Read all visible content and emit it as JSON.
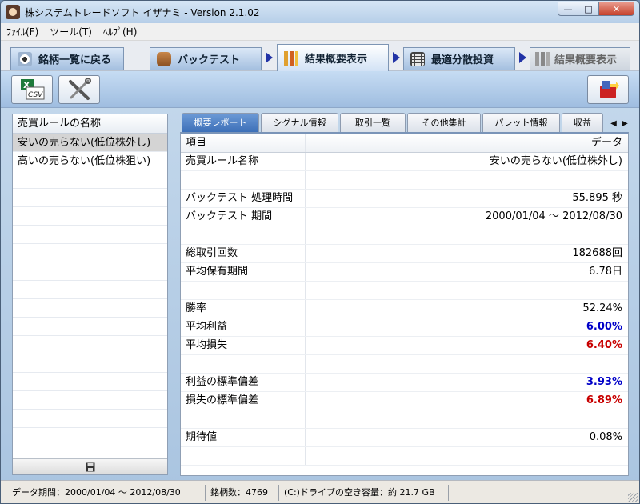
{
  "window": {
    "title": "株システムトレードソフト イザナミ - Version 2.1.02"
  },
  "menu": [
    "ﾌｧｲﾙ(F)",
    "ツール(T)",
    "ﾍﾙﾌﾟ(H)"
  ],
  "nav": {
    "tabs": [
      {
        "label": "銘柄一覧に戻る",
        "icon": "eye-icon"
      },
      {
        "label": "バックテスト",
        "icon": "bag-icon"
      },
      {
        "label": "結果概要表示",
        "icon": "bar-chart-icon",
        "active": true
      },
      {
        "label": "最適分散投資",
        "icon": "calculator-icon"
      },
      {
        "label": "結果概要表示",
        "icon": "bar-chart-icon",
        "disabled": true
      }
    ]
  },
  "toolbar": {
    "csv_label": "CSV"
  },
  "rules_list": {
    "header": "売買ルールの名称",
    "items": [
      "安いの売らない(低位株外し)",
      "高いの売らない(低位株狙い)"
    ],
    "selected_index": 0
  },
  "report_tabs": [
    "概要レポート",
    "シグナル情報",
    "取引一覧",
    "その他集計",
    "パレット情報",
    "収益"
  ],
  "report_grid": {
    "col_item": "項目",
    "col_data": "データ",
    "rows": [
      {
        "item": "売買ルール名称",
        "value": "安いの売らない(低位株外し)"
      },
      {
        "item": "",
        "value": ""
      },
      {
        "item": "バックテスト 処理時間",
        "value": "55.895 秒"
      },
      {
        "item": "バックテスト 期間",
        "value": "2000/01/04 ～ 2012/08/30"
      },
      {
        "item": "",
        "value": ""
      },
      {
        "item": "総取引回数",
        "value": "182688回"
      },
      {
        "item": "平均保有期間",
        "value": "6.78日"
      },
      {
        "item": "",
        "value": ""
      },
      {
        "item": "勝率",
        "value": "52.24%"
      },
      {
        "item": "平均利益",
        "value": "6.00%",
        "color": "blue"
      },
      {
        "item": "平均損失",
        "value": "6.40%",
        "color": "red"
      },
      {
        "item": "",
        "value": ""
      },
      {
        "item": "利益の標準偏差",
        "value": "3.93%",
        "color": "blue"
      },
      {
        "item": "損失の標準偏差",
        "value": "6.89%",
        "color": "red"
      },
      {
        "item": "",
        "value": ""
      },
      {
        "item": "期待値",
        "value": "0.08%"
      }
    ]
  },
  "status": {
    "period": "データ期間：2000/01/04 ～ 2012/08/30",
    "stock_count": "銘柄数：4769",
    "disk_free": "(C:)ドライブの空き容量：約 21.7 GB"
  },
  "colors": {
    "accent": "#3c6fb8",
    "positive": "#0000c8",
    "negative": "#c80000",
    "nav_arrow": "#2233a6"
  }
}
